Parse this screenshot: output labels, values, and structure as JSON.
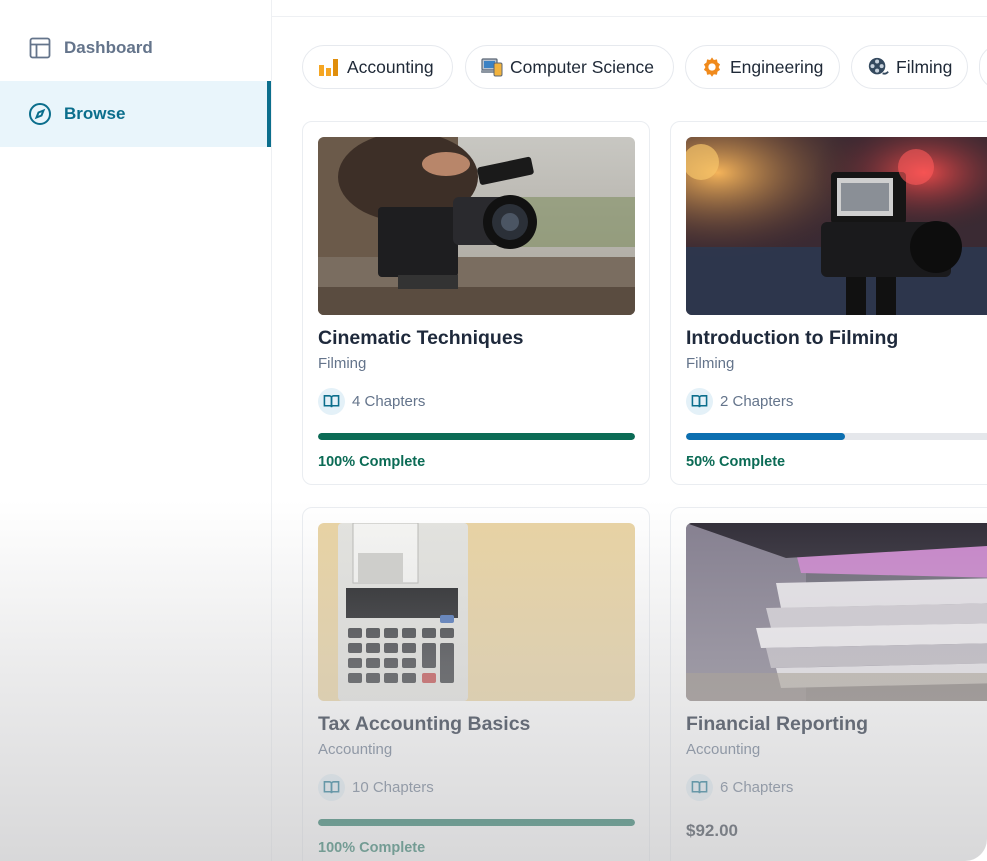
{
  "sidebar": {
    "items": [
      {
        "label": "Dashboard",
        "icon": "layout-icon",
        "active": false
      },
      {
        "label": "Browse",
        "icon": "compass-icon",
        "active": true
      }
    ]
  },
  "categories": [
    {
      "label": "Accounting",
      "icon": "bar-chart-icon"
    },
    {
      "label": "Computer Science",
      "icon": "computer-icon"
    },
    {
      "label": "Engineering",
      "icon": "gear-icon"
    },
    {
      "label": "Filming",
      "icon": "film-reel-icon"
    }
  ],
  "courses": [
    {
      "title": "Cinematic Techniques",
      "category": "Filming",
      "chapters": "4 Chapters",
      "progress_text": "100% Complete",
      "progress": 1.0
    },
    {
      "title": "Introduction to Filming",
      "category": "Filming",
      "chapters": "2 Chapters",
      "progress_text": "50% Complete",
      "progress": 0.5
    },
    {
      "title": "Tax Accounting Basics",
      "category": "Accounting",
      "chapters": "10 Chapters",
      "progress_text": "100% Complete",
      "progress": 1.0
    },
    {
      "title": "Financial Reporting",
      "category": "Accounting",
      "chapters": "6 Chapters",
      "price": "$92.00"
    }
  ],
  "colors": {
    "accent": "#0b6e8c",
    "complete": "#0b6b55",
    "in_progress": "#0c6fb0"
  }
}
